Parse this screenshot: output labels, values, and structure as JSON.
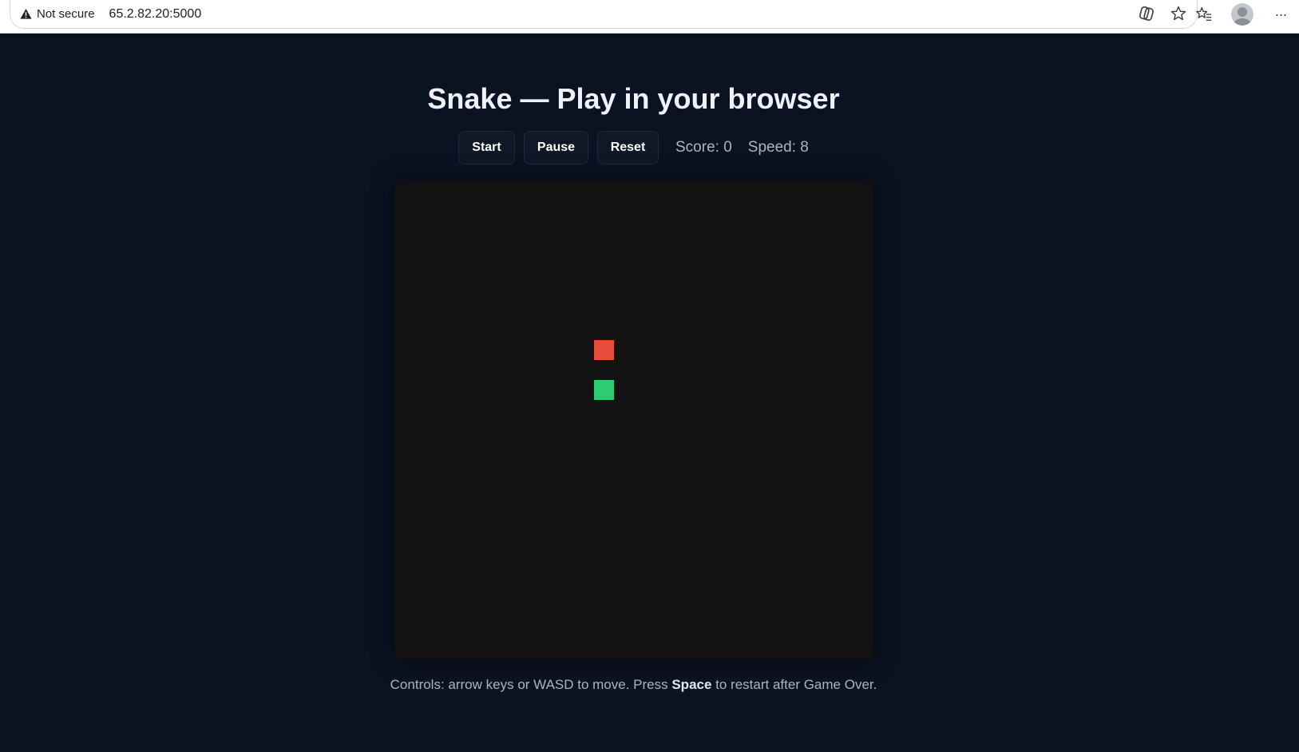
{
  "browser": {
    "security_label": "Not secure",
    "url": "65.2.82.20:5000"
  },
  "page": {
    "title": "Snake — Play in your browser",
    "buttons": {
      "start": "Start",
      "pause": "Pause",
      "reset": "Reset"
    },
    "score_label": "Score: 0",
    "speed_label": "Speed: 8",
    "footer": {
      "prefix": "Controls: arrow keys or WASD to move. Press ",
      "key": "Space",
      "suffix": " to restart after Game Over."
    }
  },
  "game": {
    "grid_size": 24,
    "food": {
      "col": 10,
      "row": 8,
      "color": "#e74c3c"
    },
    "snake": [
      {
        "col": 10,
        "row": 10
      }
    ],
    "snake_color": "#2ecc71",
    "board_color": "#121212"
  },
  "colors": {
    "background": "#0b1222",
    "title": "#eef2f8",
    "muted_text": "#aab4c3"
  }
}
